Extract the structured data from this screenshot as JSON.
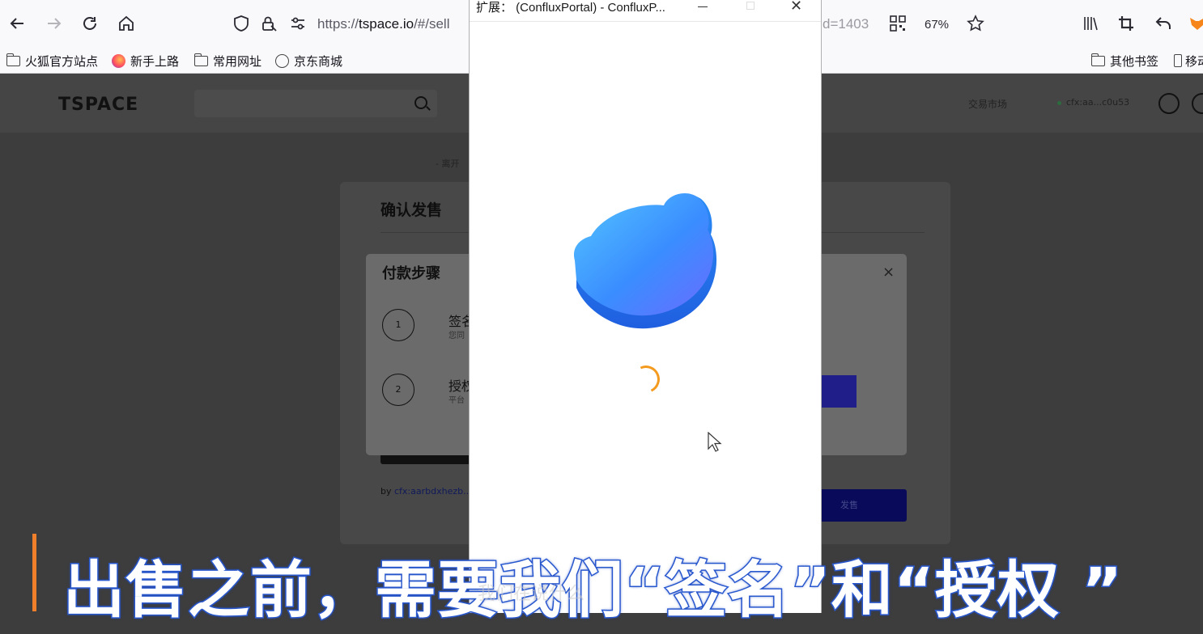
{
  "browser": {
    "url_main": "https://",
    "url_host": "tspace.io",
    "url_path": "/#/sell",
    "url_tail": "d=1403",
    "zoom": "67%",
    "icons": [
      "back-icon",
      "forward-icon",
      "reload-icon",
      "home-icon",
      "shield-icon",
      "lock-icon",
      "permissions-icon",
      "qr-code-icon",
      "star-icon",
      "library-icon",
      "crop-icon",
      "undo-icon",
      "fox-extension-icon"
    ]
  },
  "bookmarks": {
    "items": [
      "火狐官方站点",
      "新手上路",
      "常用网址",
      "京东商城"
    ],
    "other": "其他书签",
    "mobile": "移动"
  },
  "site": {
    "logo": "TSPACE",
    "nav_market": "交易市场",
    "wallet": "cfx:aa...c0u53",
    "breadcrumb": "- 离开",
    "card_title": "确认发售",
    "by_prefix": "by",
    "by_address": "cfx:aarbdxhezb...",
    "sell_button": "发售"
  },
  "steps_modal": {
    "title": "付款步骤",
    "close": "×",
    "steps": [
      {
        "num": "1",
        "label": "签名",
        "sub": "您同"
      },
      {
        "num": "2",
        "label": "授权",
        "sub": "平台"
      }
    ]
  },
  "popup": {
    "title": "扩展：  (ConfluxPortal) - ConfluxP...",
    "close": "✕"
  },
  "caption": {
    "text": "出售之前，需要我们“签名”和“授权 ”",
    "ghost": "我们在说什么"
  },
  "colors": {
    "caption_stroke": "#2e5fd6",
    "caption_bar": "#ef7f2a",
    "spinner": "#f39a1f",
    "bear_light": "#46b6ff",
    "bear_dark": "#2a73ff"
  }
}
